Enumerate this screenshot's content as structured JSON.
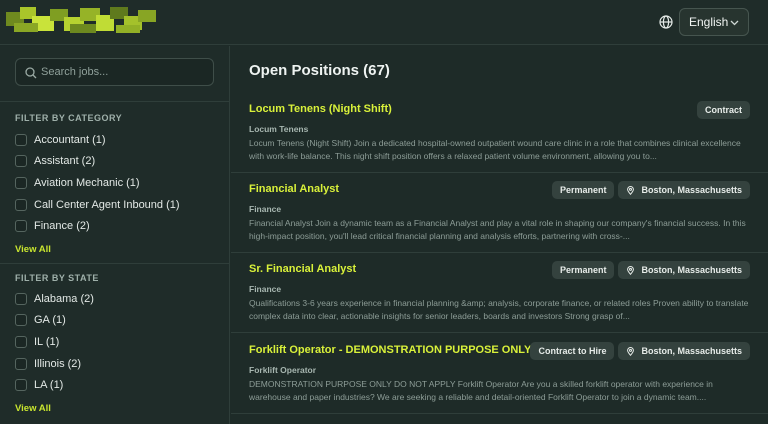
{
  "header": {
    "language": "English",
    "globe_icon": "globe-icon",
    "chevron_icon": "chevron-down-icon"
  },
  "sidebar": {
    "search_placeholder": "Search jobs...",
    "category_title": "FILTER BY CATEGORY",
    "categories": [
      "Accountant (1)",
      "Assistant (2)",
      "Aviation Mechanic (1)",
      "Call Center Agent Inbound (1)",
      "Finance (2)"
    ],
    "category_view_all": "View All",
    "state_title": "FILTER BY STATE",
    "states": [
      "Alabama (2)",
      "GA (1)",
      "IL (1)",
      "Illinois (2)",
      "LA (1)"
    ],
    "state_view_all": "View All"
  },
  "main": {
    "title": "Open Positions (67)",
    "jobs": [
      {
        "title": "Locum Tenens (Night Shift)",
        "category": "Locum Tenens",
        "type": "Contract",
        "location": "",
        "description": "Locum Tenens (Night Shift) Join a dedicated hospital-owned outpatient wound care clinic in a role that combines clinical excellence with work-life balance. This night shift position offers a relaxed patient volume environment, allowing you to..."
      },
      {
        "title": "Financial Analyst",
        "category": "Finance",
        "type": "Permanent",
        "location": "Boston, Massachusetts",
        "description": "Financial Analyst Join a dynamic team as a Financial Analyst and play a vital role in shaping our company's financial success. In this high-impact position, you'll lead critical financial planning and analysis efforts, partnering with cross-..."
      },
      {
        "title": "Sr. Financial Analyst",
        "category": "Finance",
        "type": "Permanent",
        "location": "Boston, Massachusetts",
        "description": "Qualifications 3-6 years experience in financial planning &amp; analysis, corporate finance, or related roles Proven ability to translate complex data into clear, actionable insights for senior leaders, boards and investors Strong grasp of..."
      },
      {
        "title": "Forklift Operator - DEMONSTRATION PURPOSE ONLY",
        "category": "Forklift Operator",
        "type": "Contract to Hire",
        "location": "Boston, Massachusetts",
        "description": "DEMONSTRATION PURPOSE ONLY DO NOT APPLY Forklift Operator Are you a skilled forklift operator with experience in warehouse and paper industries? We are seeking a reliable and detail-oriented Forklift Operator to join a dynamic team...."
      }
    ]
  },
  "colors": {
    "accent": "#d9f13a",
    "background": "#1e2b28"
  }
}
